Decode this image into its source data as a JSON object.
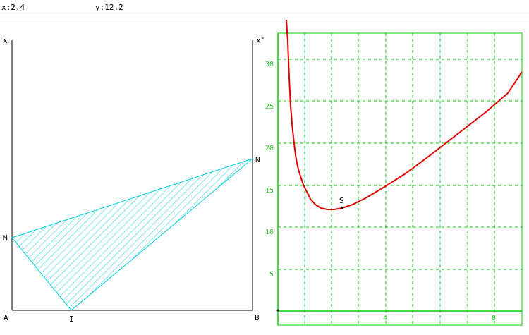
{
  "status": {
    "x_readout": "x:2.4",
    "y_readout": "y:12.2"
  },
  "geometry": {
    "labels": {
      "x": "x",
      "x_prime": "x'",
      "A": "A",
      "B": "B",
      "I": "I",
      "M": "M",
      "N": "N"
    },
    "fill_color": "#00d0e0"
  },
  "graph": {
    "point_label": "S",
    "curve_color": "#e00000",
    "grid_color": "#00d000",
    "y_tick_labels": [
      "30",
      "25",
      "20",
      "15",
      "10",
      "5"
    ],
    "x_tick_labels": [
      "4",
      "8"
    ]
  }
}
